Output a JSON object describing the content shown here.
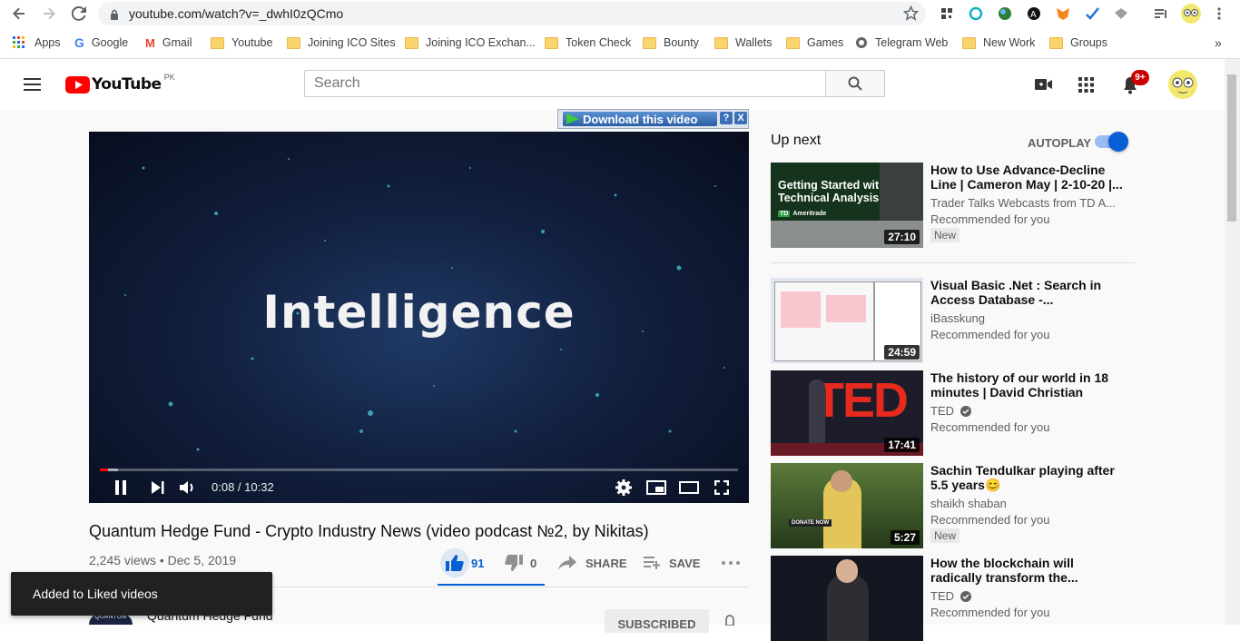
{
  "browser": {
    "url": "youtube.com/watch?v=_dwhI0zQCmo",
    "bookmarks": [
      "Apps",
      "Google",
      "Gmail",
      "Youtube",
      "Joining ICO Sites",
      "Joining ICO Exchan...",
      "Token Check",
      "Bounty",
      "Wallets",
      "Games",
      "Telegram Web",
      "New Work",
      "Groups"
    ],
    "more": "»"
  },
  "header": {
    "logo_text": "YouTube",
    "region": "PK",
    "search_placeholder": "Search",
    "notif_count": "9+"
  },
  "downloader": {
    "label": "Download this video",
    "help": "?",
    "close": "X"
  },
  "player": {
    "frame_text": "Intelligence",
    "time": "0:08 / 10:32",
    "progress": 0.013,
    "buffered": 0.028
  },
  "video": {
    "title": "Quantum Hedge Fund - Crypto Industry News (video podcast №2, by Nikitas)",
    "views_date": "2,245 views • Dec 5, 2019",
    "likes": "91",
    "dislikes": "0",
    "share": "SHARE",
    "save": "SAVE",
    "channel": "Quantum Hedge Fund",
    "channel_avatar_text": "QUANTUM",
    "subscribe": "SUBSCRIBED"
  },
  "toast": "Added to Liked videos",
  "sidebar": {
    "up_next": "Up next",
    "autoplay": "AUTOPLAY",
    "items": [
      {
        "title": "How to Use Advance-Decline Line | Cameron May | 2-10-20 |...",
        "channel": "Trader Talks Webcasts from TD A...",
        "rec": "Recommended for you",
        "badge": "New",
        "duration": "27:10",
        "thumb_title": "Getting Started with Technical Analysis",
        "thumb_brand": "Ameritrade"
      },
      {
        "title": "Visual Basic .Net : Search in Access Database -...",
        "channel": "iBasskung",
        "rec": "Recommended for you",
        "badge": "",
        "duration": "24:59"
      },
      {
        "title": "The history of our world in 18 minutes | David Christian",
        "channel": "TED",
        "rec": "Recommended for you",
        "badge": "",
        "duration": "17:41",
        "thumb_text": "TED"
      },
      {
        "title": "Sachin Tendulkar playing after 5.5 years😊",
        "channel": "shaikh shaban",
        "rec": "Recommended for you",
        "badge": "New",
        "duration": "5:27",
        "thumb_text": "DONATE NOW"
      },
      {
        "title": "How the blockchain will radically transform the...",
        "channel": "TED",
        "rec": "Recommended for you",
        "badge": "",
        "duration": ""
      }
    ]
  }
}
